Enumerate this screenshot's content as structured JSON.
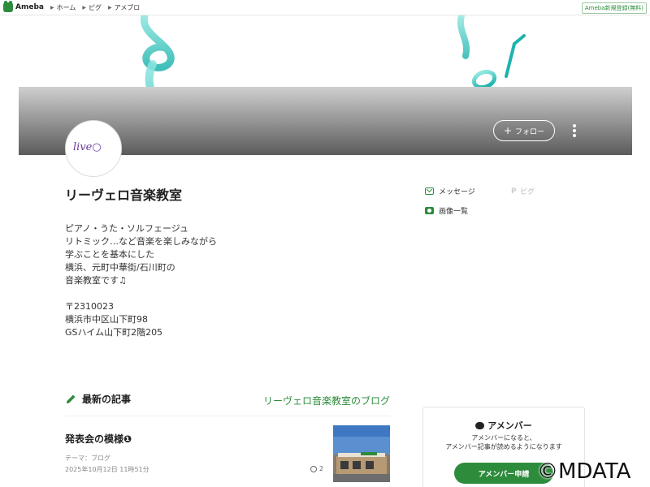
{
  "topbar": {
    "logo_text": "Ameba",
    "nav": [
      "ホーム",
      "ピグ",
      "アメブロ"
    ],
    "register_label": "Ameba新規登録(無料)"
  },
  "header": {
    "avatar_text": "live○",
    "follow_label": "フォロー"
  },
  "profile": {
    "blog_title": "リーヴェロ音楽教室",
    "description": "ピアノ・うた・ソルフェージュ\nリトミック…など音楽を楽しみながら\n学ぶことを基本にした\n横浜、元町中華街/石川町の\n音楽教室です♫\n\n〒2310023\n横浜市中区山下町98\nGSハイム山下町2階205",
    "links": {
      "message": "メッセージ",
      "pig": "ピグ",
      "images": "画像一覧"
    }
  },
  "latest": {
    "heading": "最新の記事",
    "blog_link": "リーヴェロ音楽教室のブログ",
    "article": {
      "title": "発表会の模様❶",
      "theme": "テーマ：ブログ",
      "date": "2025年10月12日 11時51分",
      "comments": "2"
    }
  },
  "amember": {
    "title": "アメンバー",
    "description": "アメンバーになると、\nアメンバー記事が読めるようになります",
    "button_label": "アメンバー申請"
  },
  "watermark": "©MDATA",
  "colors": {
    "brand_green": "#2d8c3c",
    "banner_teal": "#3cc6c0"
  },
  "icons": [
    "ameba-logo-icon",
    "message-icon",
    "pig-icon",
    "camera-icon",
    "pencil-icon",
    "comment-icon",
    "kebab-menu-icon",
    "plus-icon",
    "speech-bubble-icon"
  ]
}
